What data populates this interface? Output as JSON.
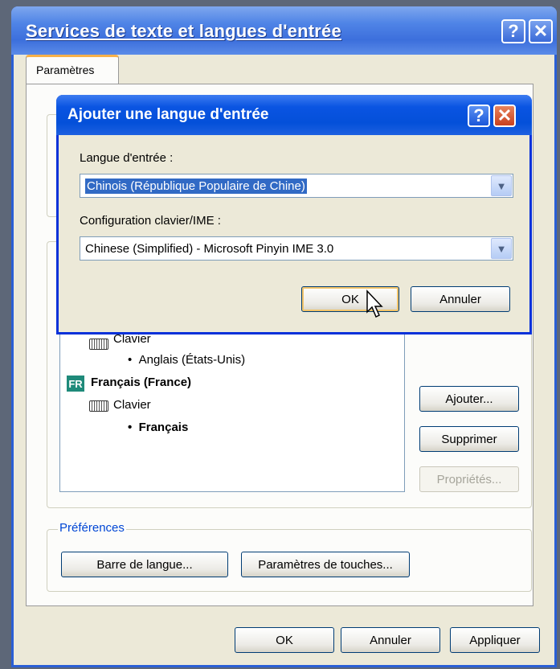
{
  "outer_window": {
    "title": "Services de texte et langues d'entrée",
    "help_label": "?",
    "close_label": "✕",
    "tab_label": "Paramètres",
    "installed": [
      {
        "kind": "keyboard",
        "label": "Clavier"
      },
      {
        "kind": "layout",
        "label": "Anglais (États-Unis)"
      },
      {
        "kind": "language",
        "badge": "FR",
        "label": "Français (France)"
      },
      {
        "kind": "keyboard",
        "label": "Clavier"
      },
      {
        "kind": "layout",
        "label": "Français"
      }
    ],
    "buttons": {
      "add": "Ajouter...",
      "remove": "Supprimer",
      "properties": "Propriétés..."
    },
    "preferences": {
      "legend": "Préférences",
      "language_bar": "Barre de langue...",
      "key_settings": "Paramètres de touches..."
    },
    "footer": {
      "ok": "OK",
      "cancel": "Annuler",
      "apply": "Appliquer"
    }
  },
  "inner_dialog": {
    "title": "Ajouter une langue d'entrée",
    "help_label": "?",
    "close_label": "✕",
    "input_language_label": "Langue d'entrée :",
    "input_language_value": "Chinois (République Populaire de Chine)",
    "keyboard_label": "Configuration clavier/IME :",
    "keyboard_value": "Chinese (Simplified) - Microsoft Pinyin IME 3.0",
    "ok": "OK",
    "cancel": "Annuler"
  },
  "colors": {
    "titlebar": "#0a54e2",
    "close_button": "#c9401e",
    "selection": "#316ac5",
    "fr_badge": "#1f8a7a"
  }
}
